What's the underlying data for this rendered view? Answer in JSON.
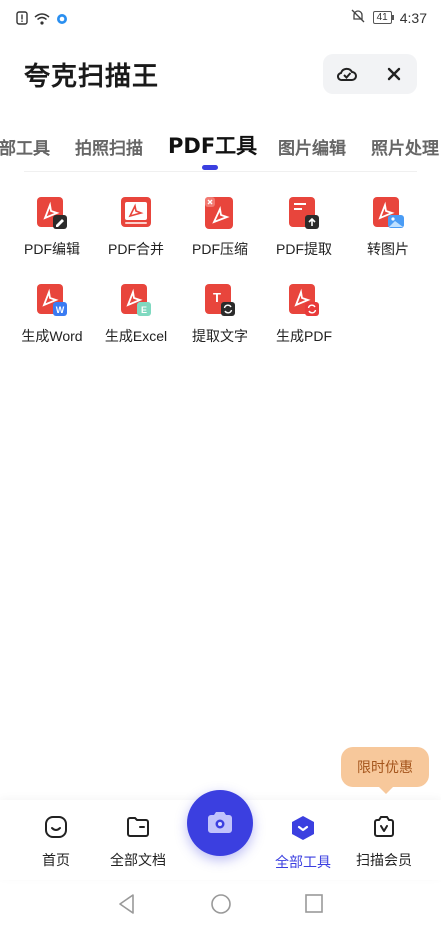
{
  "status_bar": {
    "time": "4:37",
    "battery": "41"
  },
  "app": {
    "title": "夸克扫描王"
  },
  "top_actions": {
    "scan_check_icon": "cloud-check-icon",
    "close_label": "×"
  },
  "tabs": [
    {
      "label": "部工具",
      "active": false
    },
    {
      "label": "拍照扫描",
      "active": false
    },
    {
      "label": "PDF工具",
      "active": true
    },
    {
      "label": "图片编辑",
      "active": false
    },
    {
      "label": "照片处理",
      "active": false
    }
  ],
  "tools": [
    {
      "label": "PDF编辑",
      "icon": "pdf-edit-icon"
    },
    {
      "label": "PDF合并",
      "icon": "pdf-merge-icon"
    },
    {
      "label": "PDF压缩",
      "icon": "pdf-compress-icon"
    },
    {
      "label": "PDF提取",
      "icon": "pdf-extract-icon"
    },
    {
      "label": "转图片",
      "icon": "pdf-to-image-icon"
    },
    {
      "label": "生成Word",
      "icon": "pdf-to-word-icon"
    },
    {
      "label": "生成Excel",
      "icon": "pdf-to-excel-icon"
    },
    {
      "label": "提取文字",
      "icon": "extract-text-icon"
    },
    {
      "label": "生成PDF",
      "icon": "create-pdf-icon"
    }
  ],
  "promo": {
    "label": "限时优惠"
  },
  "bottom_nav": {
    "home": "首页",
    "all_docs": "全部文档",
    "all_tools": "全部工具",
    "membership": "扫描会员"
  },
  "colors": {
    "accent": "#3b3fe0",
    "pdf_red": "#e8453c",
    "promo_bg": "#f7c89b"
  }
}
